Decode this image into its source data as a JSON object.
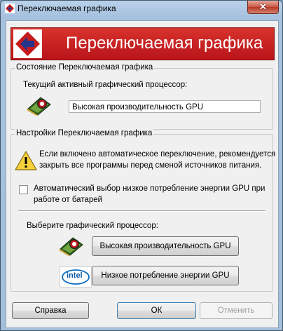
{
  "window": {
    "title": "Переключаемая графика",
    "close_glyph": "✕"
  },
  "banner": {
    "title": "Переключаемая графика"
  },
  "status_group": {
    "label": "Состояние Переключаемая графика",
    "active_gpu_label": "Текущий активный графический процессор:",
    "active_gpu_value": "Высокая производительность GPU"
  },
  "settings_group": {
    "label": "Настройки Переключаемая графика",
    "warning_line1": "Если включено автоматическое переключение, рекомендуется",
    "warning_line2": "закрыть все программы перед сменой источников питания.",
    "auto_select_line1": "Автоматический выбор низкое потребление энергии GPU при",
    "auto_select_line2": "работе от батарей",
    "auto_select_checked": false,
    "choose_gpu_label": "Выберите графический процессор:",
    "high_perf_button": "Высокая производительность GPU",
    "low_power_button": "Низкое потребление энергии GPU",
    "intel_logo_text": "intel"
  },
  "footer": {
    "help_button": "Справка",
    "ok_button": "ОК",
    "cancel_button": "Отменить"
  },
  "icons": [
    "amd-logo-icon",
    "warning-icon",
    "gpu-chip-icon",
    "intel-logo-icon",
    "close-icon"
  ]
}
